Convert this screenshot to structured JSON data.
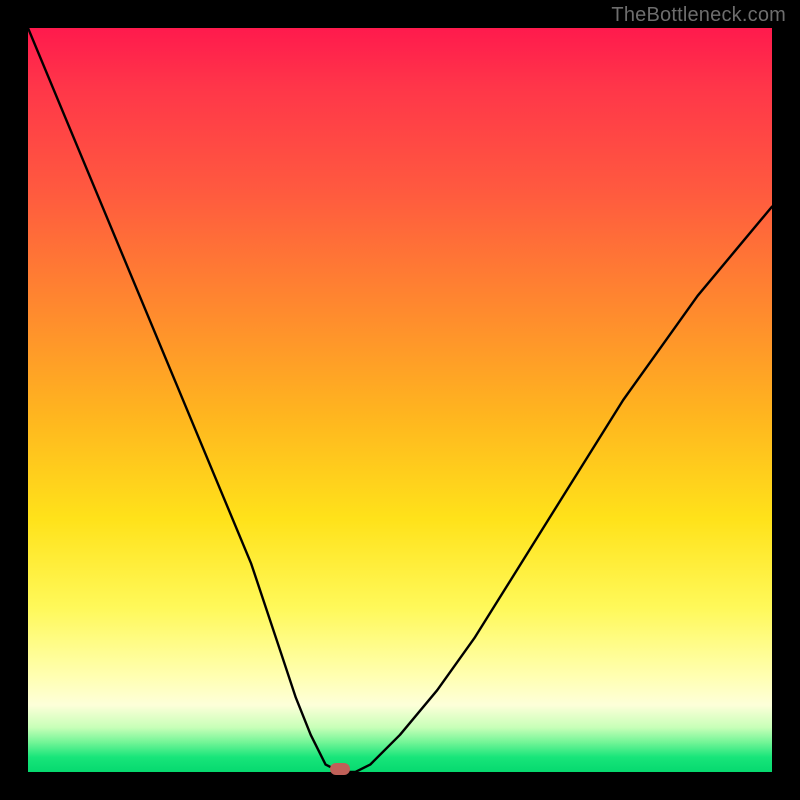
{
  "watermark": "TheBottleneck.com",
  "colors": {
    "frame": "#000000",
    "curve": "#000000",
    "marker": "#c06058",
    "gradient_top": "#ff1a4d",
    "gradient_bottom": "#06d96f"
  },
  "chart_data": {
    "type": "line",
    "title": "",
    "xlabel": "",
    "ylabel": "",
    "xlim": [
      0,
      100
    ],
    "ylim": [
      0,
      100
    ],
    "grid": false,
    "legend": false,
    "x": [
      0,
      5,
      10,
      15,
      20,
      25,
      30,
      34,
      36,
      38,
      40,
      42,
      44,
      46,
      50,
      55,
      60,
      65,
      70,
      75,
      80,
      85,
      90,
      95,
      100
    ],
    "y": [
      100,
      88,
      76,
      64,
      52,
      40,
      28,
      16,
      10,
      5,
      1,
      0,
      0,
      1,
      5,
      11,
      18,
      26,
      34,
      42,
      50,
      57,
      64,
      70,
      76
    ],
    "marker": {
      "x": 42,
      "y": 0
    },
    "note": "V-shaped bottleneck curve; minimum (optimal, ~0% bottleneck) near x≈42. Left branch rises to 100% at x=0; right branch rises to ~76% at x=100."
  }
}
